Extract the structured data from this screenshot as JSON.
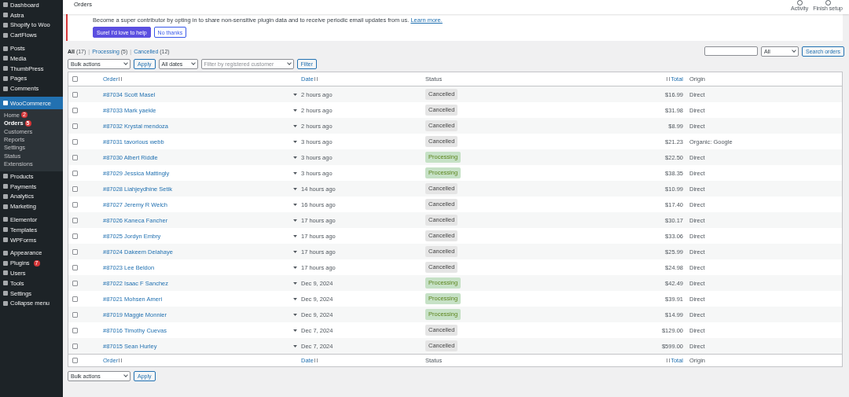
{
  "sidebar": {
    "groups": [
      [
        {
          "label": "Dashboard",
          "selected": false
        },
        {
          "label": "Astra",
          "selected": false
        },
        {
          "label": "Shopify to Woo",
          "selected": false
        },
        {
          "label": "CartFlows",
          "selected": false
        }
      ],
      [
        {
          "label": "Posts",
          "selected": false
        },
        {
          "label": "Media",
          "selected": false
        },
        {
          "label": "ThumbPress",
          "selected": false
        },
        {
          "label": "Pages",
          "selected": false
        },
        {
          "label": "Comments",
          "selected": false
        }
      ],
      [
        {
          "label": "WooCommerce",
          "selected": true,
          "children": [
            {
              "label": "Home",
              "selected": false,
              "badge": "2"
            },
            {
              "label": "Orders",
              "selected": true,
              "badge": "5"
            },
            {
              "label": "Customers",
              "selected": false
            },
            {
              "label": "Reports",
              "selected": false
            },
            {
              "label": "Settings",
              "selected": false
            },
            {
              "label": "Status",
              "selected": false
            },
            {
              "label": "Extensions",
              "selected": false
            }
          ]
        },
        {
          "label": "Products",
          "selected": false
        },
        {
          "label": "Payments",
          "selected": false
        },
        {
          "label": "Analytics",
          "selected": false
        },
        {
          "label": "Marketing",
          "selected": false
        }
      ],
      [
        {
          "label": "Elementor",
          "selected": false
        },
        {
          "label": "Templates",
          "selected": false
        },
        {
          "label": "WPForms",
          "selected": false
        }
      ],
      [
        {
          "label": "Appearance",
          "selected": false
        },
        {
          "label": "Plugins",
          "selected": false,
          "badge": "7"
        },
        {
          "label": "Users",
          "selected": false
        },
        {
          "label": "Tools",
          "selected": false
        },
        {
          "label": "Settings",
          "selected": false
        },
        {
          "label": "Collapse menu",
          "selected": false
        }
      ]
    ]
  },
  "header": {
    "title": "Orders",
    "actions": [
      {
        "label": "Activity"
      },
      {
        "label": "Finish setup"
      }
    ]
  },
  "notice": {
    "text": "Become a super contributor by opting in to share non-sensitive plugin data and to receive periodic email updates from us.",
    "link": "Learn more.",
    "primary_button": "Sure! I'd love to help",
    "secondary_button": "No thanks"
  },
  "views": {
    "separator": "|",
    "items": [
      {
        "label": "All",
        "count": "(17)",
        "selected": true
      },
      {
        "label": "Processing",
        "count": "(5)",
        "selected": false
      },
      {
        "label": "Cancelled",
        "count": "(12)",
        "selected": false
      }
    ]
  },
  "search": {
    "status_select": "All",
    "button": "Search orders"
  },
  "filters": {
    "bulk_actions": "Bulk actions",
    "apply": "Apply",
    "dates": "All dates",
    "customer_placeholder": "Filter by registered customer",
    "filter": "Filter"
  },
  "table": {
    "select_all_checked": false,
    "columns": [
      {
        "label": "Order",
        "sortable": true
      },
      {
        "label": "Date",
        "sortable": true
      },
      {
        "label": "Status",
        "sortable": false
      },
      {
        "label": "Total",
        "sortable": true
      },
      {
        "label": "Origin",
        "sortable": false
      }
    ],
    "rows": [
      {
        "checked": false,
        "order": "#87034 Scott Masel",
        "date": "2 hours ago",
        "status": {
          "label": "Cancelled",
          "kind": "cancelled"
        },
        "total": "$16.99",
        "origin": "Direct"
      },
      {
        "checked": false,
        "order": "#87033 Mark yaekle",
        "date": "2 hours ago",
        "status": {
          "label": "Cancelled",
          "kind": "cancelled"
        },
        "total": "$31.98",
        "origin": "Direct"
      },
      {
        "checked": false,
        "order": "#87032 Krystal mendoza",
        "date": "2 hours ago",
        "status": {
          "label": "Cancelled",
          "kind": "cancelled"
        },
        "total": "$8.99",
        "origin": "Direct"
      },
      {
        "checked": false,
        "order": "#87031 tavorious webb",
        "date": "3 hours ago",
        "status": {
          "label": "Cancelled",
          "kind": "cancelled"
        },
        "total": "$21.23",
        "origin": "Organic: Google"
      },
      {
        "checked": false,
        "order": "#87030 Albert Riddle",
        "date": "3 hours ago",
        "status": {
          "label": "Processing",
          "kind": "processing"
        },
        "total": "$22.50",
        "origin": "Direct"
      },
      {
        "checked": false,
        "order": "#87029 Jessica Mattingly",
        "date": "3 hours ago",
        "status": {
          "label": "Processing",
          "kind": "processing"
        },
        "total": "$38.35",
        "origin": "Direct"
      },
      {
        "checked": false,
        "order": "#87028 Liahjeydhine Setik",
        "date": "14 hours ago",
        "status": {
          "label": "Cancelled",
          "kind": "cancelled"
        },
        "total": "$10.99",
        "origin": "Direct"
      },
      {
        "checked": false,
        "order": "#87027 Jeremy R Welch",
        "date": "16 hours ago",
        "status": {
          "label": "Cancelled",
          "kind": "cancelled"
        },
        "total": "$17.40",
        "origin": "Direct"
      },
      {
        "checked": false,
        "order": "#87026 Kaneca Fancher",
        "date": "17 hours ago",
        "status": {
          "label": "Cancelled",
          "kind": "cancelled"
        },
        "total": "$30.17",
        "origin": "Direct"
      },
      {
        "checked": false,
        "order": "#87025 Jordyn Embry",
        "date": "17 hours ago",
        "status": {
          "label": "Cancelled",
          "kind": "cancelled"
        },
        "total": "$33.06",
        "origin": "Direct"
      },
      {
        "checked": false,
        "order": "#87024 Dakeem Delahaye",
        "date": "17 hours ago",
        "status": {
          "label": "Cancelled",
          "kind": "cancelled"
        },
        "total": "$25.99",
        "origin": "Direct"
      },
      {
        "checked": false,
        "order": "#87023 Lee Beldon",
        "date": "17 hours ago",
        "status": {
          "label": "Cancelled",
          "kind": "cancelled"
        },
        "total": "$24.98",
        "origin": "Direct"
      },
      {
        "checked": false,
        "order": "#87022 Isaac F Sanchez",
        "date": "Dec 9, 2024",
        "status": {
          "label": "Processing",
          "kind": "processing"
        },
        "total": "$42.49",
        "origin": "Direct"
      },
      {
        "checked": false,
        "order": "#87021 Mohsen Ameri",
        "date": "Dec 9, 2024",
        "status": {
          "label": "Processing",
          "kind": "processing"
        },
        "total": "$39.91",
        "origin": "Direct"
      },
      {
        "checked": false,
        "order": "#87019 Maggie Monnier",
        "date": "Dec 9, 2024",
        "status": {
          "label": "Processing",
          "kind": "processing"
        },
        "total": "$14.99",
        "origin": "Direct"
      },
      {
        "checked": false,
        "order": "#87016 Timothy Cuevas",
        "date": "Dec 7, 2024",
        "status": {
          "label": "Cancelled",
          "kind": "cancelled"
        },
        "total": "$129.00",
        "origin": "Direct"
      },
      {
        "checked": false,
        "order": "#87015 Sean Hurley",
        "date": "Dec 7, 2024",
        "status": {
          "label": "Cancelled",
          "kind": "cancelled"
        },
        "total": "$599.00",
        "origin": "Direct"
      }
    ],
    "footer_select_all_checked": false,
    "footer_columns": [
      {
        "label": "Order",
        "sortable": true
      },
      {
        "label": "Date",
        "sortable": true
      },
      {
        "label": "Status",
        "sortable": false
      },
      {
        "label": "Total",
        "sortable": true
      },
      {
        "label": "Origin",
        "sortable": false
      }
    ]
  },
  "bottom_actions": {
    "bulk_actions": "Bulk actions",
    "apply": "Apply"
  }
}
